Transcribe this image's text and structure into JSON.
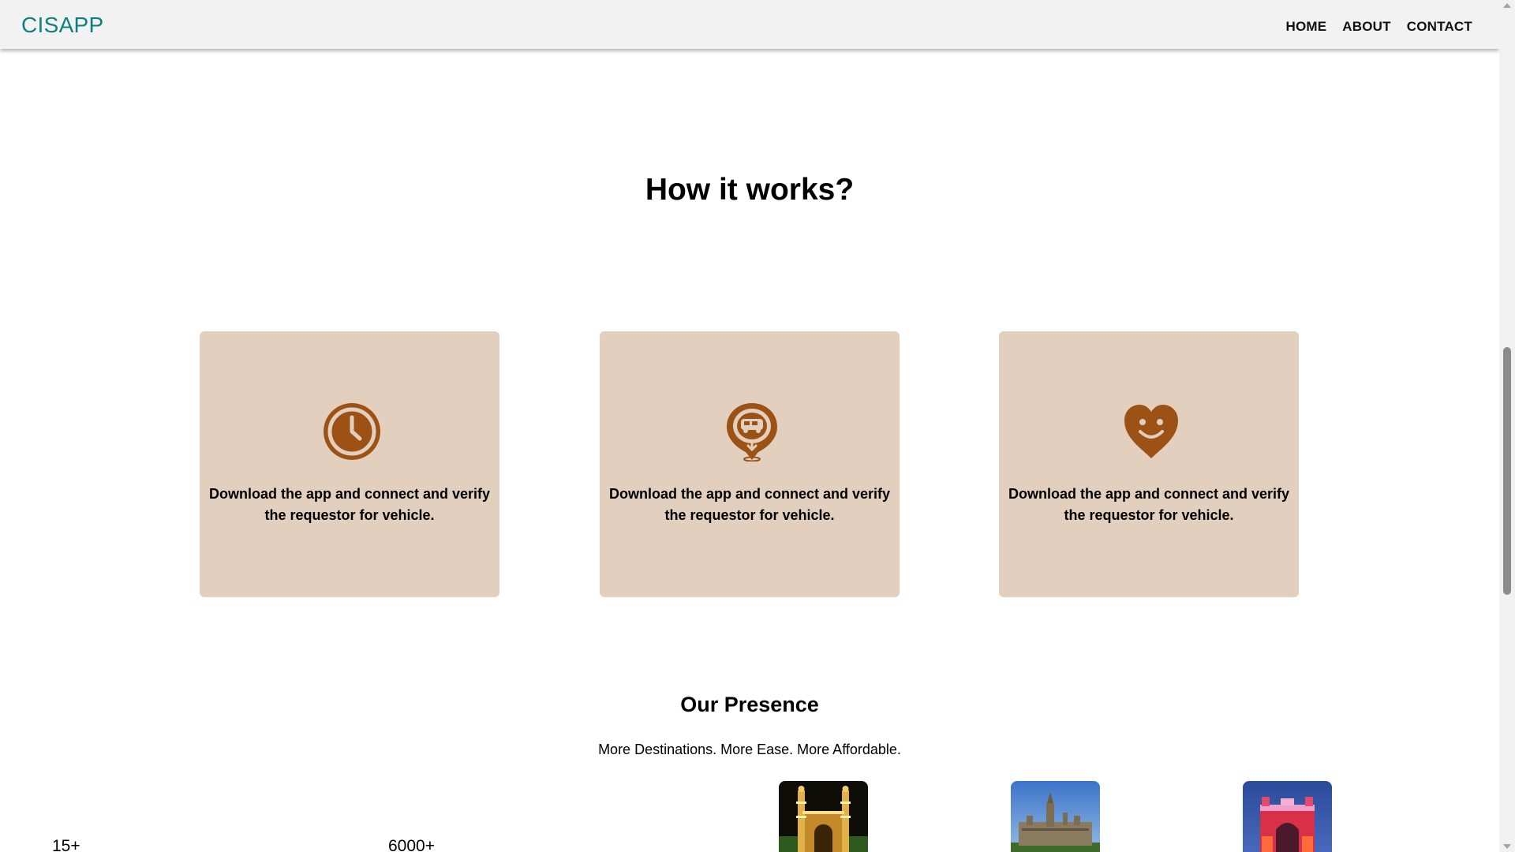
{
  "navbar": {
    "brand": "CISAPP",
    "links": [
      "HOME",
      "ABOUT",
      "CONTACT"
    ]
  },
  "how_it_works": {
    "title": "How it works?",
    "cards": [
      {
        "icon": "clock-icon",
        "text": "Download the app and connect and verify the requestor for vehicle."
      },
      {
        "icon": "vehicle-location-pin-icon",
        "text": "Download the app and connect and verify the requestor for vehicle."
      },
      {
        "icon": "smiley-heart-icon",
        "text": "Download the app and connect and verify the requestor for vehicle."
      }
    ]
  },
  "presence": {
    "title": "Our Presence",
    "subtitle": "More Destinations. More Ease. More Affordable.",
    "stats": [
      "15+",
      "6000+"
    ],
    "city_images": [
      "charminar-image",
      "palace-image",
      "gateway-of-india-image"
    ]
  },
  "colors": {
    "brand": "#0f8080",
    "card_bg": "#e2cfbd",
    "icon": "#9c5215"
  }
}
